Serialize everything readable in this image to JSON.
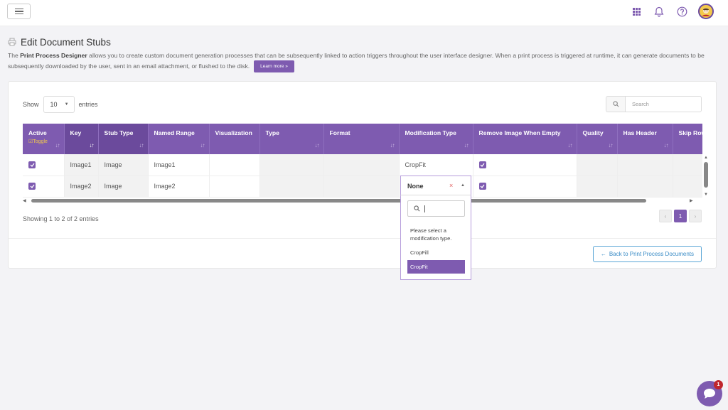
{
  "header": {
    "icons": [
      "hamburger-menu-icon",
      "apps-grid-icon",
      "bell-icon",
      "help-icon",
      "user-avatar-icon"
    ]
  },
  "page": {
    "title": "Edit Document Stubs",
    "description_bold": "Print Process Designer",
    "description_rest": " allows you to create custom document generation processes that can be subsequently linked to action triggers throughout the user interface designer. When a print process is triggered at runtime, it can generate documents to be subsequently downloaded by the user, sent in an email attachment, or flushed to the disk.",
    "description_prefix": "The ",
    "learn_more": "Learn more »"
  },
  "controls": {
    "show_label": "Show",
    "entries_value": "10",
    "entries_label": "entries",
    "search_placeholder": "Search"
  },
  "table": {
    "columns": [
      {
        "label": "Active",
        "extra": "Toggle"
      },
      {
        "label": "Key"
      },
      {
        "label": "Stub Type"
      },
      {
        "label": "Named Range"
      },
      {
        "label": "Visualization"
      },
      {
        "label": "Type"
      },
      {
        "label": "Format"
      },
      {
        "label": "Modification Type"
      },
      {
        "label": "Remove Image When Empty"
      },
      {
        "label": "Quality"
      },
      {
        "label": "Has Header"
      },
      {
        "label": "Skip Rows"
      }
    ],
    "rows": [
      {
        "active": true,
        "key": "Image1",
        "stub_type": "Image",
        "named_range": "Image1",
        "visualization": "",
        "type": "",
        "format": "",
        "modification_type": "CropFit",
        "remove_image_when_empty": true,
        "quality": "",
        "has_header": "",
        "skip_rows": ""
      },
      {
        "active": true,
        "key": "Image2",
        "stub_type": "Image",
        "named_range": "Image2",
        "visualization": "",
        "type": "",
        "format": "",
        "modification_type": "None",
        "remove_image_when_empty": true,
        "quality": "",
        "has_header": "",
        "skip_rows": ""
      }
    ]
  },
  "footer": {
    "showing": "Showing 1 to 2 of 2 entries",
    "current_page": "1",
    "back_button": "Back to Print Process Documents"
  },
  "dropdown": {
    "selected": "None",
    "clear": "×",
    "note": "Please select a modification type.",
    "options": [
      "CropFill",
      "CropFit"
    ],
    "highlighted": "CropFit"
  },
  "chat": {
    "badge": "1"
  },
  "colors": {
    "accent": "#7e5bb0",
    "header_sorted": "#6b4a9c",
    "toggle": "#f2c94c",
    "back_link": "#3a8cc6",
    "badge": "#c0272d"
  }
}
